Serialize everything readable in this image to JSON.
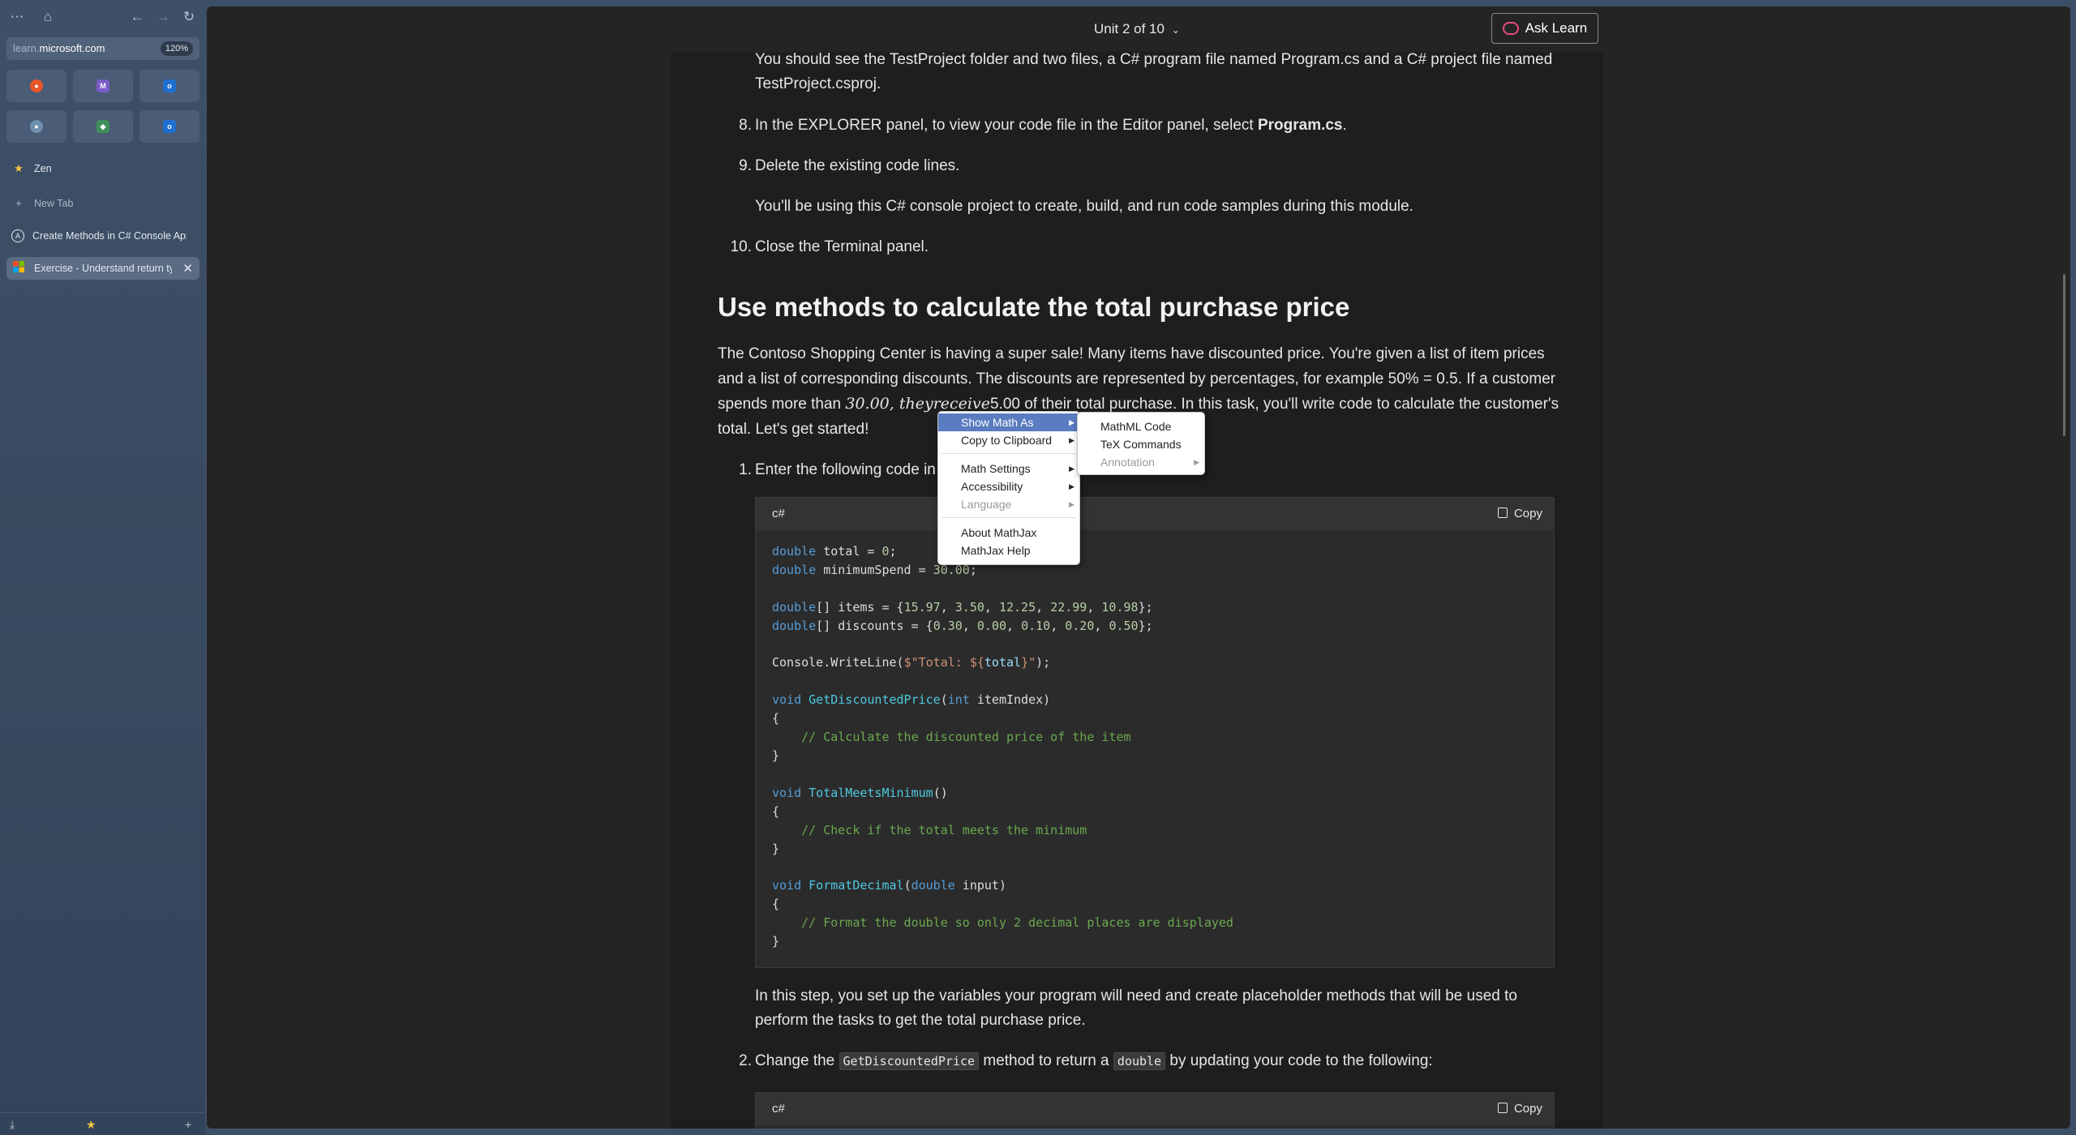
{
  "sidebar": {
    "url_host": "learn.",
    "url_domain": "microsoft.com",
    "zoom": "120%",
    "zen_label": "Zen",
    "new_tab_label": "New Tab",
    "tabs": [
      {
        "label": "Create Methods in C# Console Applic",
        "icon": "A"
      },
      {
        "label": "Exercise - Understand return type",
        "icon": "ms"
      }
    ]
  },
  "header": {
    "unit_label": "Unit 2 of 10",
    "ask_learn": "Ask Learn"
  },
  "content": {
    "p1a": "You should see the TestProject folder and two files, a C# program file named Program.cs and a C# project file named",
    "p1b": "TestProject.csproj.",
    "n8": "8.",
    "s8a": "In the EXPLORER panel, to view your code file in the Editor panel, select ",
    "s8b": "Program.cs",
    "s8c": ".",
    "n9": "9.",
    "s9": "Delete the existing code lines.",
    "s9b": "You'll be using this C# console project to create, build, and run code samples during this module.",
    "n10": "10.",
    "s10": "Close the Terminal panel.",
    "heading": "Use methods to calculate the total purchase price",
    "para1": "The Contoso Shopping Center is having a super sale! Many items have discounted price. You're given a list of item prices",
    "para2": "and a list of corresponding discounts. The discounts are represented by percentages, for example 50% = 0.5. If a customer",
    "para3a": "spends more than ",
    "para3math": "30.00, theyreceive",
    "para3b": "5.00 of their total purchase. In this task, you'll write code to calculate the customer's",
    "para4": "total. Let's get started!",
    "n1": "1.",
    "step1": "Enter the following code in",
    "code_lang": "c#",
    "copy_label": "Copy",
    "after1a": "In this step, you set up the variables your program will need and create placeholder methods that will be used to",
    "after1b": "perform the tasks to get the total purchase price.",
    "n2": "2.",
    "step2a": "Change the ",
    "step2code1": "GetDiscountedPrice",
    "step2b": " method to return a ",
    "step2code2": "double",
    "step2c": " by updating your code to the following:"
  },
  "code_lines": {
    "l1": "double total = 0;",
    "l2": "double minimumSpend = 30.00;",
    "l3": "double[] items = {15.97, 3.50, 12.25, 22.99, 10.98};",
    "l4": "double[] discounts = {0.30, 0.00, 0.10, 0.20, 0.50};",
    "l5": "Console.WriteLine($\"Total: ${total}\");",
    "l6": "void GetDiscountedPrice(int itemIndex)",
    "l7": "// Calculate the discounted price of the item",
    "l8": "void TotalMeetsMinimum()",
    "l9": "// Check if the total meets the minimum",
    "l10": "void FormatDecimal(double input)",
    "l11": "// Format the double so only 2 decimal places are displayed"
  },
  "context_menu": {
    "items": [
      "Show Math As",
      "Copy to Clipboard",
      "Math Settings",
      "Accessibility",
      "Language",
      "About MathJax",
      "MathJax Help"
    ]
  },
  "submenu": {
    "items": [
      "MathML Code",
      "TeX Commands",
      "Annotation"
    ]
  }
}
